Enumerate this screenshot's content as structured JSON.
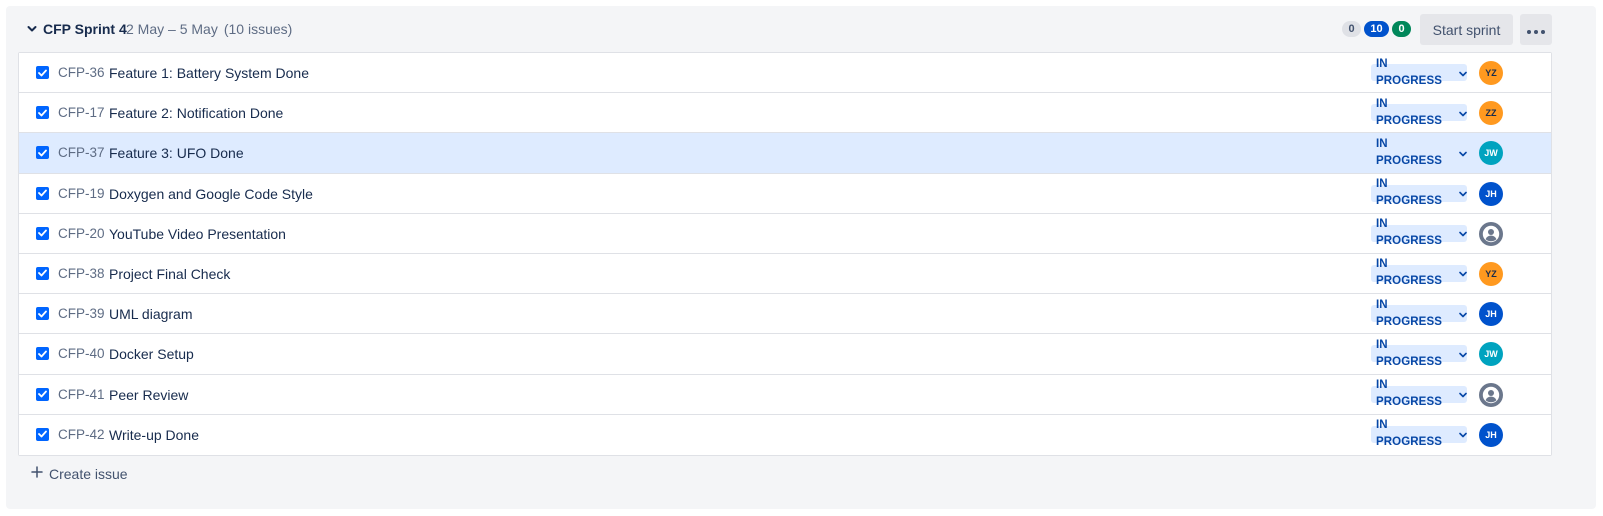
{
  "sprint": {
    "name": "CFP Sprint 4",
    "dates": "2 May – 5 May",
    "issue_count": "(10 issues)",
    "counts": {
      "todo": "0",
      "in_progress": "10",
      "done": "0"
    },
    "start_button": "Start sprint",
    "more_icon": "more-horizontal-icon"
  },
  "issues": [
    {
      "key": "CFP-36",
      "summary": "Feature 1: Battery System Done",
      "status": "IN PROGRESS",
      "assignee": "YZ",
      "avatar_color": "#ff991f"
    },
    {
      "key": "CFP-17",
      "summary": "Feature 2: Notification Done",
      "status": "IN PROGRESS",
      "assignee": "ZZ",
      "avatar_color": "#ff991f"
    },
    {
      "key": "CFP-37",
      "summary": "Feature 3: UFO Done",
      "status": "IN PROGRESS",
      "assignee": "JW",
      "avatar_color": "#00a3bf"
    },
    {
      "key": "CFP-19",
      "summary": "Doxygen and Google Code Style",
      "status": "IN PROGRESS",
      "assignee": "JH",
      "avatar_color": "#0052cc"
    },
    {
      "key": "CFP-20",
      "summary": "YouTube Video Presentation",
      "status": "IN PROGRESS",
      "assignee": "",
      "avatar_color": "#6b778c"
    },
    {
      "key": "CFP-38",
      "summary": "Project Final Check",
      "status": "IN PROGRESS",
      "assignee": "YZ",
      "avatar_color": "#ff991f"
    },
    {
      "key": "CFP-39",
      "summary": "UML diagram",
      "status": "IN PROGRESS",
      "assignee": "JH",
      "avatar_color": "#0052cc"
    },
    {
      "key": "CFP-40",
      "summary": "Docker Setup",
      "status": "IN PROGRESS",
      "assignee": "JW",
      "avatar_color": "#00a3bf"
    },
    {
      "key": "CFP-41",
      "summary": "Peer Review",
      "status": "IN PROGRESS",
      "assignee": "",
      "avatar_color": "#6b778c"
    },
    {
      "key": "CFP-42",
      "summary": "Write-up Done",
      "status": "IN PROGRESS",
      "assignee": "JH",
      "avatar_color": "#0052cc"
    }
  ],
  "create_issue": {
    "label": "Create issue"
  },
  "colors": {
    "accent": "#0052cc",
    "status_bg": "#deebff",
    "status_text": "#0747a6",
    "selected_row": "#deebff",
    "panel_bg": "#f4f5f7"
  }
}
